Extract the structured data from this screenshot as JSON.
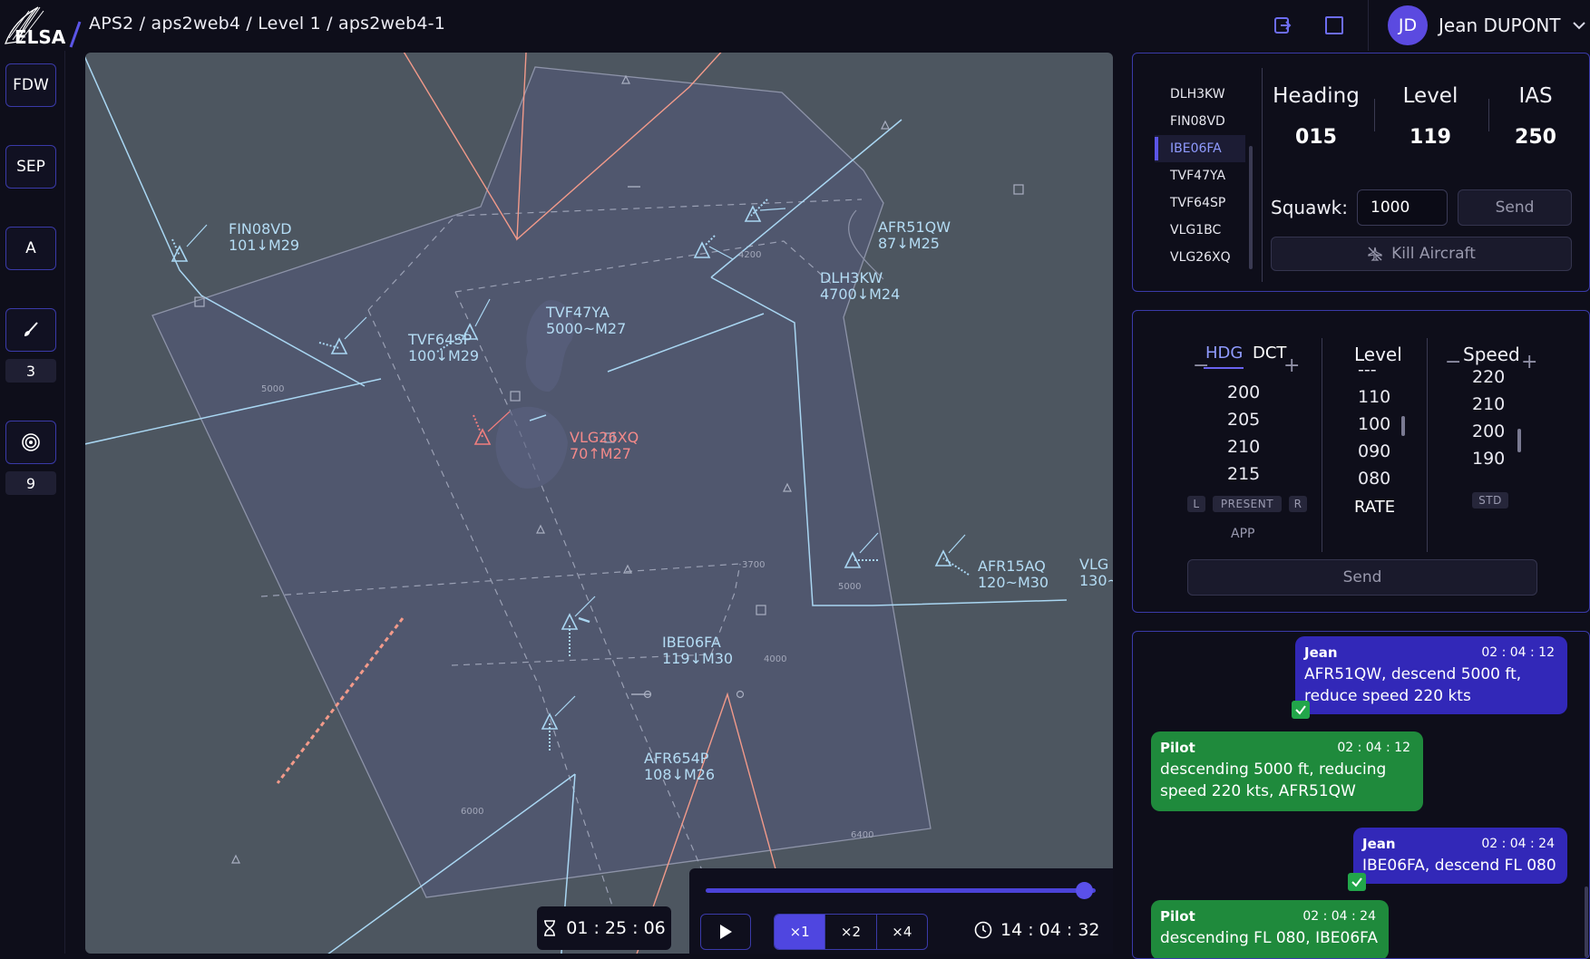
{
  "header": {
    "logo_text": "ELSA",
    "breadcrumb": "APS2 / aps2web4 / Level 1 / aps2web4-1",
    "icons": [
      "exit-icon",
      "fullscreen-icon"
    ],
    "user": {
      "initials": "JD",
      "name": "Jean DUPONT"
    }
  },
  "toolbar": {
    "fdw": "FDW",
    "sep": "SEP",
    "a": "A",
    "brush_count": "3",
    "target_count": "9"
  },
  "radar": {
    "aircraft": [
      {
        "callsign": "FIN08VD",
        "data": "101↓M29"
      },
      {
        "callsign": "TVF64SP",
        "data": "100↓M29"
      },
      {
        "callsign": "TVF47YA",
        "data": "5000~M27"
      },
      {
        "callsign": "VLG26XQ",
        "data": "70↑M27"
      },
      {
        "callsign": "AFR51QW",
        "data": "87↓M25"
      },
      {
        "callsign": "DLH3KW",
        "data": "4700↓M24"
      },
      {
        "callsign": "AFR15AQ",
        "data": "120~M30"
      },
      {
        "callsign": "VLG",
        "data": "130~"
      },
      {
        "callsign": "IBE06FA",
        "data": "119↓M30"
      },
      {
        "callsign": "AFR654P",
        "data": "108↓M26"
      }
    ],
    "altitude_labels": [
      "4200",
      "5000",
      "3700",
      "5000",
      "4000",
      "6000",
      "6400"
    ]
  },
  "playback": {
    "elapsed": "01 : 25 : 06",
    "speeds": [
      "×1",
      "×2",
      "×4"
    ],
    "active_speed": "×1",
    "clock": "14 : 04 : 32",
    "progress": 0.97
  },
  "aircraft_panel": {
    "callsigns": [
      "DLH3KW",
      "FIN08VD",
      "IBE06FA",
      "TVF47YA",
      "TVF64SP",
      "VLG1BC",
      "VLG26XQ"
    ],
    "selected": "IBE06FA",
    "heading_label": "Heading",
    "heading_value": "015",
    "level_label": "Level",
    "level_value": "119",
    "ias_label": "IAS",
    "ias_value": "250",
    "squawk_label": "Squawk:",
    "squawk_value": "1000",
    "send_label": "Send",
    "kill_label": "Kill Aircraft"
  },
  "clearance_panel": {
    "tab_hdg": "HDG",
    "tab_dct": "DCT",
    "heading_values": [
      "200",
      "205",
      "210",
      "215"
    ],
    "btn_l": "L",
    "btn_present": "PRESENT",
    "btn_r": "R",
    "btn_app": "APP",
    "level_title": "Level",
    "level_partial": "---",
    "level_values": [
      "110",
      "100",
      "090",
      "080"
    ],
    "rate_label": "RATE",
    "speed_title": "Speed",
    "speed_values": [
      "220",
      "210",
      "200",
      "190"
    ],
    "btn_std": "STD",
    "send_label": "Send"
  },
  "chat": [
    {
      "from": "Jean",
      "time": "02 : 04 : 12",
      "text": "AFR51QW, descend 5000 ft, reduce speed 220 kts",
      "line1": "AFR51QW, descend 5000 ft,",
      "line2": "reduce speed 220 kts"
    },
    {
      "from": "Pilot",
      "time": "02 : 04 : 12",
      "line1": "descending 5000 ft, reducing",
      "line2": "speed 220 kts, AFR51QW"
    },
    {
      "from": "Jean",
      "time": "02 : 04 : 24",
      "line1": "IBE06FA, descend FL 080"
    },
    {
      "from": "Pilot",
      "time": "02 : 04 : 24",
      "line1": "descending FL 080, IBE06FA"
    }
  ],
  "colors": {
    "accent": "#4f46e0",
    "border": "#3a3aa8",
    "track": "#a9d6f2",
    "alert": "#f07e7e",
    "route": "#f29a8a",
    "atc_bubble": "#3228b8",
    "pilot_bubble": "#1f8a3c"
  }
}
